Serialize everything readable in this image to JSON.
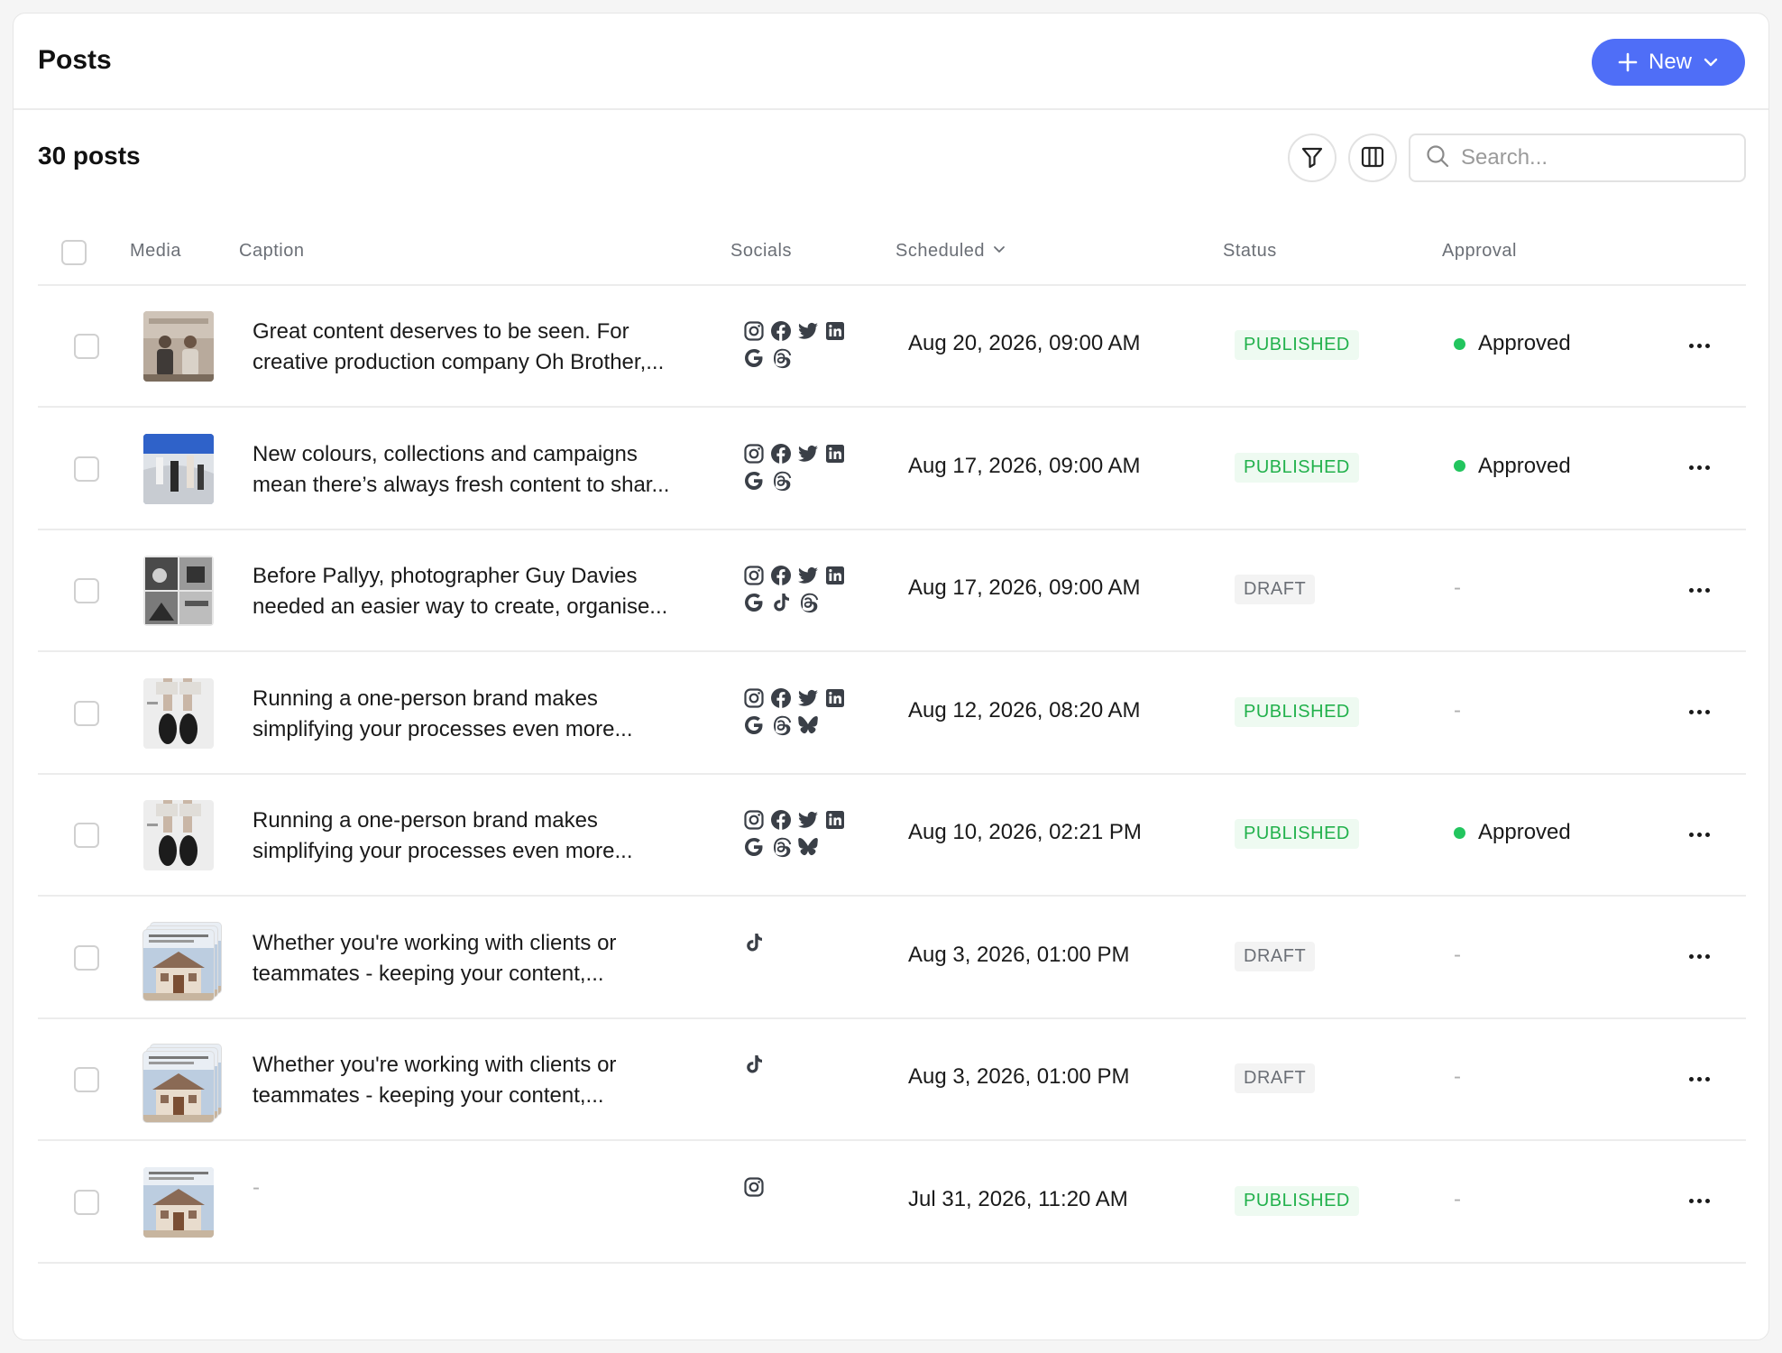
{
  "header": {
    "title": "Posts",
    "new_label": "New"
  },
  "toolbar": {
    "count_label": "30 posts",
    "search_placeholder": "Search..."
  },
  "columns": {
    "media": "Media",
    "caption": "Caption",
    "socials": "Socials",
    "scheduled": "Scheduled",
    "status": "Status",
    "approval": "Approval"
  },
  "colors": {
    "accent": "#4f6ef7",
    "published_text": "#22b14c",
    "published_bg": "#eefaf1",
    "draft_text": "#6b6f76",
    "approved_dot": "#22c55e"
  },
  "posts": [
    {
      "caption_line1": "Great content deserves to be seen. For",
      "caption_line2": "creative production company Oh Brother,...",
      "socials": [
        "instagram-icon",
        "facebook-icon",
        "twitter-icon",
        "linkedin-icon",
        "google-icon",
        "threads-icon"
      ],
      "scheduled": "Aug 20, 2026, 09:00 AM",
      "status": "PUBLISHED",
      "approval": "Approved",
      "media": "people-photo"
    },
    {
      "caption_line1": "New colours, collections and campaigns",
      "caption_line2": "mean there’s always fresh content to shar...",
      "socials": [
        "instagram-icon",
        "facebook-icon",
        "twitter-icon",
        "linkedin-icon",
        "google-icon",
        "threads-icon"
      ],
      "scheduled": "Aug 17, 2026, 09:00 AM",
      "status": "PUBLISHED",
      "approval": "Approved",
      "media": "beach-photo"
    },
    {
      "caption_line1": "Before Pallyy, photographer Guy Davies",
      "caption_line2": "needed an easier way to create, organise...",
      "socials": [
        "instagram-icon",
        "facebook-icon",
        "twitter-icon",
        "linkedin-icon",
        "google-icon",
        "tiktok-icon",
        "threads-icon"
      ],
      "scheduled": "Aug 17, 2026, 09:00 AM",
      "status": "DRAFT",
      "approval": "-",
      "media": "bw-collage"
    },
    {
      "caption_line1": "Running a one-person brand makes",
      "caption_line2": "simplifying your processes even more...",
      "socials": [
        "instagram-icon",
        "facebook-icon",
        "twitter-icon",
        "linkedin-icon",
        "google-icon",
        "threads-icon",
        "bluesky-icon"
      ],
      "scheduled": "Aug 12, 2026, 08:20 AM",
      "status": "PUBLISHED",
      "approval": "-",
      "media": "shoes-photo"
    },
    {
      "caption_line1": "Running a one-person brand makes",
      "caption_line2": "simplifying your processes even more...",
      "socials": [
        "instagram-icon",
        "facebook-icon",
        "twitter-icon",
        "linkedin-icon",
        "google-icon",
        "threads-icon",
        "bluesky-icon"
      ],
      "scheduled": "Aug 10, 2026, 02:21 PM",
      "status": "PUBLISHED",
      "approval": "Approved",
      "media": "shoes-photo"
    },
    {
      "caption_line1": "Whether you're working with clients or",
      "caption_line2": "teammates - keeping your content,...",
      "socials": [
        "tiktok-icon"
      ],
      "scheduled": "Aug 3, 2026, 01:00 PM",
      "status": "DRAFT",
      "approval": "-",
      "media": "house-stack"
    },
    {
      "caption_line1": "Whether you're working with clients or",
      "caption_line2": "teammates - keeping your content,...",
      "socials": [
        "tiktok-icon"
      ],
      "scheduled": "Aug 3, 2026, 01:00 PM",
      "status": "DRAFT",
      "approval": "-",
      "media": "house-stack"
    },
    {
      "caption_line1": "-",
      "caption_line2": "",
      "socials": [
        "instagram-icon"
      ],
      "scheduled": "Jul 31, 2026, 11:20 AM",
      "status": "PUBLISHED",
      "approval": "-",
      "media": "house-photo"
    }
  ]
}
